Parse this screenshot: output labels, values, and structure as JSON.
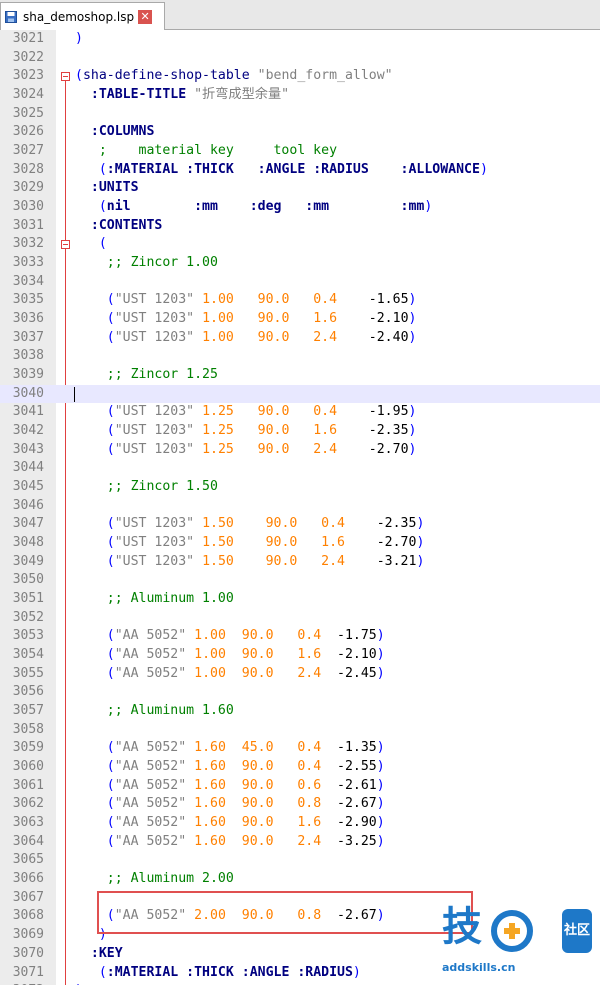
{
  "tab": {
    "label": "sha_demoshop.lsp",
    "close_glyph": "✕"
  },
  "watermark": {
    "brand_char": "技",
    "badge": "社区",
    "url": "addskills.cn"
  },
  "colors": {
    "keyword": "#000080",
    "string": "#808080",
    "number": "#ff8000",
    "comment": "#008000",
    "paren": "#0000ff",
    "fold_marker": "#e04040",
    "highlight_box": "#e05050"
  },
  "editor": {
    "current_line": "3040",
    "lines": [
      {
        "n": "3021",
        "t": [
          [
            ")",
            "paren"
          ]
        ]
      },
      {
        "n": "3022",
        "t": []
      },
      {
        "n": "3023",
        "t": [
          [
            "(",
            "paren"
          ],
          [
            "sha-define-shop-table ",
            "defun"
          ],
          [
            "\"bend_form_allow\"",
            "str"
          ]
        ]
      },
      {
        "n": "3024",
        "t": [
          [
            "  :TABLE-TITLE ",
            "kw"
          ],
          [
            "\"折弯成型余量\"",
            "str"
          ]
        ]
      },
      {
        "n": "3025",
        "t": []
      },
      {
        "n": "3026",
        "t": [
          [
            "  :COLUMNS",
            "kw"
          ]
        ]
      },
      {
        "n": "3027",
        "t": [
          [
            "   ;    material key     tool key",
            "cmt"
          ]
        ]
      },
      {
        "n": "3028",
        "t": [
          [
            "   ",
            "plain"
          ],
          [
            "(",
            "paren"
          ],
          [
            ":MATERIAL :THICK   :ANGLE :RADIUS    :ALLOWANCE",
            "kw"
          ],
          [
            ")",
            "paren"
          ]
        ]
      },
      {
        "n": "3029",
        "t": [
          [
            "  :UNITS",
            "kw"
          ]
        ]
      },
      {
        "n": "3030",
        "t": [
          [
            "   ",
            "plain"
          ],
          [
            "(",
            "paren"
          ],
          [
            "nil        :mm    :deg   :mm         :mm",
            "kw"
          ],
          [
            ")",
            "paren"
          ]
        ]
      },
      {
        "n": "3031",
        "t": [
          [
            "  :CONTENTS",
            "kw"
          ]
        ]
      },
      {
        "n": "3032",
        "t": [
          [
            "   ",
            "plain"
          ],
          [
            "(",
            "paren"
          ]
        ]
      },
      {
        "n": "3033",
        "t": [
          [
            "    ;; Zincor 1.00",
            "cmt"
          ]
        ]
      },
      {
        "n": "3034",
        "t": []
      },
      {
        "n": "3035",
        "t": [
          [
            "    ",
            "plain"
          ],
          [
            "(",
            "paren"
          ],
          [
            "\"UST 1203\" ",
            "str"
          ],
          [
            "1.00   90.0   0.4",
            "num-lit"
          ],
          [
            "    -1.65",
            "plain"
          ],
          [
            ")",
            "paren"
          ]
        ]
      },
      {
        "n": "3036",
        "t": [
          [
            "    ",
            "plain"
          ],
          [
            "(",
            "paren"
          ],
          [
            "\"UST 1203\" ",
            "str"
          ],
          [
            "1.00   90.0   1.6",
            "num-lit"
          ],
          [
            "    -2.10",
            "plain"
          ],
          [
            ")",
            "paren"
          ]
        ]
      },
      {
        "n": "3037",
        "t": [
          [
            "    ",
            "plain"
          ],
          [
            "(",
            "paren"
          ],
          [
            "\"UST 1203\" ",
            "str"
          ],
          [
            "1.00   90.0   2.4",
            "num-lit"
          ],
          [
            "    -2.40",
            "plain"
          ],
          [
            ")",
            "paren"
          ]
        ]
      },
      {
        "n": "3038",
        "t": []
      },
      {
        "n": "3039",
        "t": [
          [
            "    ;; Zincor 1.25",
            "cmt"
          ]
        ]
      },
      {
        "n": "3040",
        "t": []
      },
      {
        "n": "3041",
        "t": [
          [
            "    ",
            "plain"
          ],
          [
            "(",
            "paren"
          ],
          [
            "\"UST 1203\" ",
            "str"
          ],
          [
            "1.25   90.0   0.4",
            "num-lit"
          ],
          [
            "    -1.95",
            "plain"
          ],
          [
            ")",
            "paren"
          ]
        ]
      },
      {
        "n": "3042",
        "t": [
          [
            "    ",
            "plain"
          ],
          [
            "(",
            "paren"
          ],
          [
            "\"UST 1203\" ",
            "str"
          ],
          [
            "1.25   90.0   1.6",
            "num-lit"
          ],
          [
            "    -2.35",
            "plain"
          ],
          [
            ")",
            "paren"
          ]
        ]
      },
      {
        "n": "3043",
        "t": [
          [
            "    ",
            "plain"
          ],
          [
            "(",
            "paren"
          ],
          [
            "\"UST 1203\" ",
            "str"
          ],
          [
            "1.25   90.0   2.4",
            "num-lit"
          ],
          [
            "    -2.70",
            "plain"
          ],
          [
            ")",
            "paren"
          ]
        ]
      },
      {
        "n": "3044",
        "t": []
      },
      {
        "n": "3045",
        "t": [
          [
            "    ;; Zincor 1.50",
            "cmt"
          ]
        ]
      },
      {
        "n": "3046",
        "t": []
      },
      {
        "n": "3047",
        "t": [
          [
            "    ",
            "plain"
          ],
          [
            "(",
            "paren"
          ],
          [
            "\"UST 1203\" ",
            "str"
          ],
          [
            "1.50    90.0   0.4",
            "num-lit"
          ],
          [
            "    -2.35",
            "plain"
          ],
          [
            ")",
            "paren"
          ]
        ]
      },
      {
        "n": "3048",
        "t": [
          [
            "    ",
            "plain"
          ],
          [
            "(",
            "paren"
          ],
          [
            "\"UST 1203\" ",
            "str"
          ],
          [
            "1.50    90.0   1.6",
            "num-lit"
          ],
          [
            "    -2.70",
            "plain"
          ],
          [
            ")",
            "paren"
          ]
        ]
      },
      {
        "n": "3049",
        "t": [
          [
            "    ",
            "plain"
          ],
          [
            "(",
            "paren"
          ],
          [
            "\"UST 1203\" ",
            "str"
          ],
          [
            "1.50    90.0   2.4",
            "num-lit"
          ],
          [
            "    -3.21",
            "plain"
          ],
          [
            ")",
            "paren"
          ]
        ]
      },
      {
        "n": "3050",
        "t": []
      },
      {
        "n": "3051",
        "t": [
          [
            "    ;; Aluminum 1.00",
            "cmt"
          ]
        ]
      },
      {
        "n": "3052",
        "t": []
      },
      {
        "n": "3053",
        "t": [
          [
            "    ",
            "plain"
          ],
          [
            "(",
            "paren"
          ],
          [
            "\"AA 5052\" ",
            "str"
          ],
          [
            "1.00  90.0   0.4",
            "num-lit"
          ],
          [
            "  -1.75",
            "plain"
          ],
          [
            ")",
            "paren"
          ]
        ]
      },
      {
        "n": "3054",
        "t": [
          [
            "    ",
            "plain"
          ],
          [
            "(",
            "paren"
          ],
          [
            "\"AA 5052\" ",
            "str"
          ],
          [
            "1.00  90.0   1.6",
            "num-lit"
          ],
          [
            "  -2.10",
            "plain"
          ],
          [
            ")",
            "paren"
          ]
        ]
      },
      {
        "n": "3055",
        "t": [
          [
            "    ",
            "plain"
          ],
          [
            "(",
            "paren"
          ],
          [
            "\"AA 5052\" ",
            "str"
          ],
          [
            "1.00  90.0   2.4",
            "num-lit"
          ],
          [
            "  -2.45",
            "plain"
          ],
          [
            ")",
            "paren"
          ]
        ]
      },
      {
        "n": "3056",
        "t": []
      },
      {
        "n": "3057",
        "t": [
          [
            "    ;; Aluminum 1.60",
            "cmt"
          ]
        ]
      },
      {
        "n": "3058",
        "t": []
      },
      {
        "n": "3059",
        "t": [
          [
            "    ",
            "plain"
          ],
          [
            "(",
            "paren"
          ],
          [
            "\"AA 5052\" ",
            "str"
          ],
          [
            "1.60  45.0   0.4",
            "num-lit"
          ],
          [
            "  -1.35",
            "plain"
          ],
          [
            ")",
            "paren"
          ]
        ]
      },
      {
        "n": "3060",
        "t": [
          [
            "    ",
            "plain"
          ],
          [
            "(",
            "paren"
          ],
          [
            "\"AA 5052\" ",
            "str"
          ],
          [
            "1.60  90.0   0.4",
            "num-lit"
          ],
          [
            "  -2.55",
            "plain"
          ],
          [
            ")",
            "paren"
          ]
        ]
      },
      {
        "n": "3061",
        "t": [
          [
            "    ",
            "plain"
          ],
          [
            "(",
            "paren"
          ],
          [
            "\"AA 5052\" ",
            "str"
          ],
          [
            "1.60  90.0   0.6",
            "num-lit"
          ],
          [
            "  -2.61",
            "plain"
          ],
          [
            ")",
            "paren"
          ]
        ]
      },
      {
        "n": "3062",
        "t": [
          [
            "    ",
            "plain"
          ],
          [
            "(",
            "paren"
          ],
          [
            "\"AA 5052\" ",
            "str"
          ],
          [
            "1.60  90.0   0.8",
            "num-lit"
          ],
          [
            "  -2.67",
            "plain"
          ],
          [
            ")",
            "paren"
          ]
        ]
      },
      {
        "n": "3063",
        "t": [
          [
            "    ",
            "plain"
          ],
          [
            "(",
            "paren"
          ],
          [
            "\"AA 5052\" ",
            "str"
          ],
          [
            "1.60  90.0   1.6",
            "num-lit"
          ],
          [
            "  -2.90",
            "plain"
          ],
          [
            ")",
            "paren"
          ]
        ]
      },
      {
        "n": "3064",
        "t": [
          [
            "    ",
            "plain"
          ],
          [
            "(",
            "paren"
          ],
          [
            "\"AA 5052\" ",
            "str"
          ],
          [
            "1.60  90.0   2.4",
            "num-lit"
          ],
          [
            "  -3.25",
            "plain"
          ],
          [
            ")",
            "paren"
          ]
        ]
      },
      {
        "n": "3065",
        "t": []
      },
      {
        "n": "3066",
        "t": [
          [
            "    ;; Aluminum 2.00",
            "cmt"
          ]
        ]
      },
      {
        "n": "3067",
        "t": []
      },
      {
        "n": "3068",
        "t": [
          [
            "    ",
            "plain"
          ],
          [
            "(",
            "paren"
          ],
          [
            "\"AA 5052\" ",
            "str"
          ],
          [
            "2.00  90.0   0.8",
            "num-lit"
          ],
          [
            "  -2.67",
            "plain"
          ],
          [
            ")",
            "paren"
          ]
        ]
      },
      {
        "n": "3069",
        "t": [
          [
            "   ",
            "plain"
          ],
          [
            ")",
            "paren"
          ]
        ]
      },
      {
        "n": "3070",
        "t": [
          [
            "  :KEY",
            "kw"
          ]
        ]
      },
      {
        "n": "3071",
        "t": [
          [
            "   ",
            "plain"
          ],
          [
            "(",
            "paren"
          ],
          [
            ":MATERIAL :THICK :ANGLE :RADIUS",
            "kw"
          ],
          [
            ")",
            "paren"
          ]
        ]
      },
      {
        "n": "3072",
        "t": [
          [
            ")",
            "paren"
          ]
        ]
      }
    ]
  }
}
